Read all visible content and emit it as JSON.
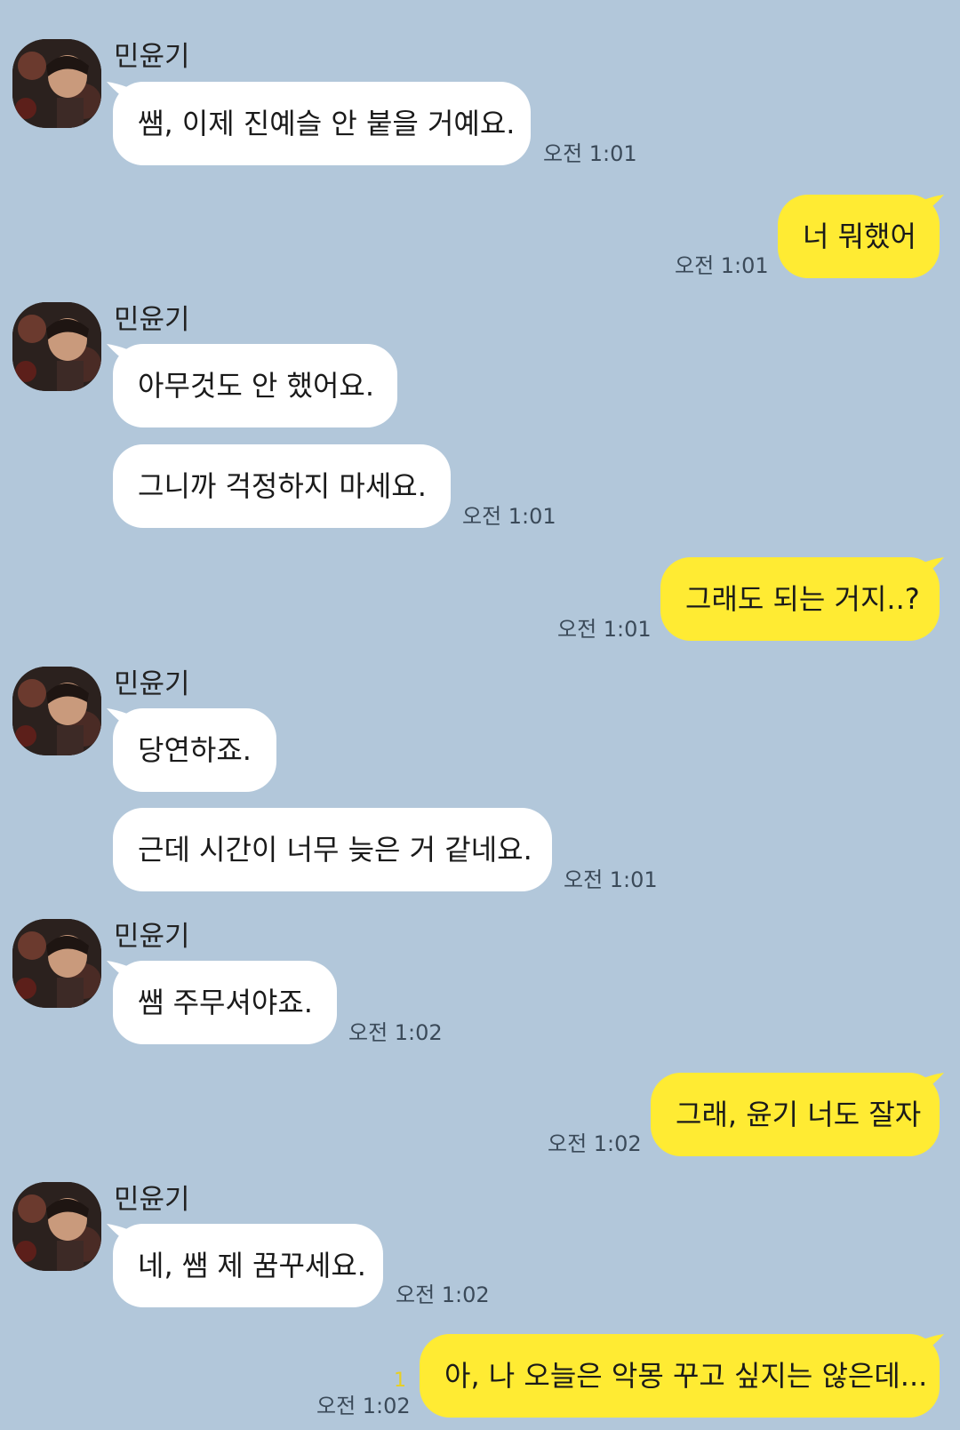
{
  "sender_name": "민윤기",
  "colors": {
    "background": "#b2c7da",
    "incoming_bubble": "#ffffff",
    "outgoing_bubble": "#ffeb33",
    "unread_count": "#e8cf22"
  },
  "messages": [
    {
      "text": "쌤, 이제 진예슬 안 붙을 거예요.",
      "time": "오전 1:01"
    },
    {
      "text": "너 뭐했어",
      "time": "오전 1:01"
    },
    {
      "text": "아무것도 안 했어요."
    },
    {
      "text": "그니까 걱정하지 마세요.",
      "time": "오전 1:01"
    },
    {
      "text": "그래도 되는 거지..?",
      "time": "오전 1:01"
    },
    {
      "text": "당연하죠."
    },
    {
      "text": "근데 시간이 너무 늦은 거 같네요.",
      "time": "오전 1:01"
    },
    {
      "text": "쌤 주무셔야죠.",
      "time": "오전 1:02"
    },
    {
      "text": "그래, 윤기 너도 잘자",
      "time": "오전 1:02"
    },
    {
      "text": "네, 쌤 제 꿈꾸세요.",
      "time": "오전 1:02"
    },
    {
      "text": "아, 나 오늘은 악몽 꾸고 싶지는 않은데...",
      "time": "오전 1:02",
      "unread": "1"
    }
  ],
  "icons": {
    "avatar": "profile-photo-icon"
  }
}
